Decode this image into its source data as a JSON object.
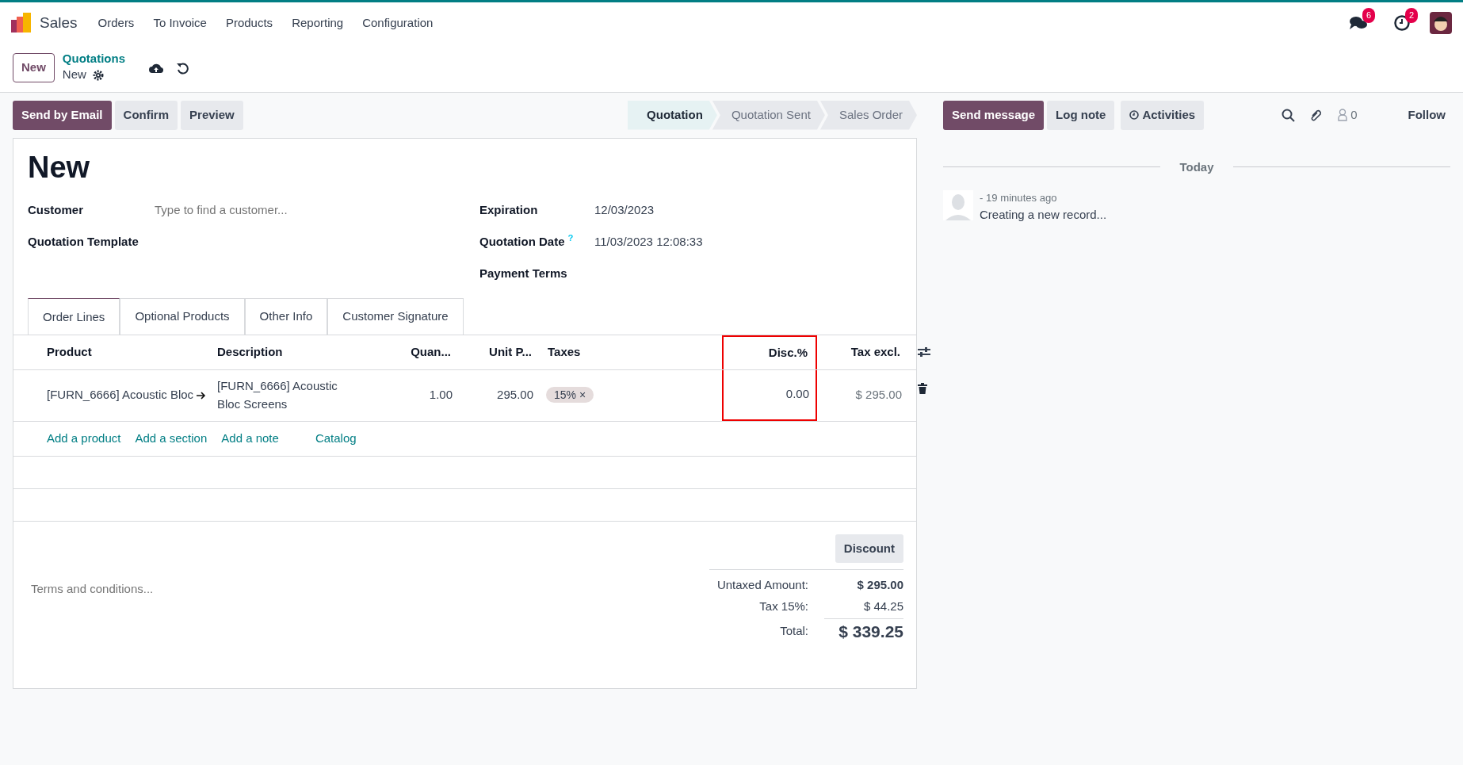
{
  "navbar": {
    "app": "Sales",
    "menu": [
      "Orders",
      "To Invoice",
      "Products",
      "Reporting",
      "Configuration"
    ],
    "messages_badge": "6",
    "activities_badge": "2"
  },
  "control_panel": {
    "new_button": "New",
    "breadcrumb": "Quotations",
    "record": "New"
  },
  "actions": [
    {
      "label": "Send by Email",
      "primary": true
    },
    {
      "label": "Confirm",
      "primary": false
    },
    {
      "label": "Preview",
      "primary": false
    }
  ],
  "stages": [
    {
      "label": "Quotation",
      "selected": true
    },
    {
      "label": "Quotation Sent",
      "selected": false
    },
    {
      "label": "Sales Order",
      "selected": false
    }
  ],
  "form": {
    "title": "New",
    "left_fields": [
      {
        "label": "Customer",
        "placeholder": "Type to find a customer..."
      },
      {
        "label": "Quotation Template"
      }
    ],
    "right_fields": [
      {
        "label": "Expiration",
        "value": "12/03/2023"
      },
      {
        "label": "Quotation Date",
        "help": "?",
        "value": "11/03/2023 12:08:33"
      },
      {
        "label": "Payment Terms"
      }
    ],
    "tabs": [
      {
        "label": "Order Lines",
        "selected": true
      },
      {
        "label": "Optional Products",
        "selected": false
      },
      {
        "label": "Other Info",
        "selected": false
      },
      {
        "label": "Customer Signature",
        "selected": false
      }
    ],
    "table": {
      "columns": [
        {
          "label": "Product",
          "kind": "text",
          "highlighted": false
        },
        {
          "label": "Description",
          "kind": "text",
          "highlighted": false
        },
        {
          "label": "Quan...",
          "kind": "number",
          "highlighted": false
        },
        {
          "label": "Unit P...",
          "kind": "number",
          "highlighted": false
        },
        {
          "label": "Taxes",
          "kind": "text",
          "highlighted": false
        },
        {
          "label": "Disc.%",
          "kind": "number",
          "highlighted": true
        },
        {
          "label": "Tax excl.",
          "kind": "number",
          "highlighted": false
        }
      ],
      "rows": [
        {
          "product": "[FURN_6666] Acoustic Bloc",
          "description": "[FURN_6666] Acoustic Bloc Screens",
          "quantity": "1.00",
          "unit_price": "295.00",
          "tax_tag": "15%",
          "remove": "×",
          "discount": "0.00",
          "subtotal": "$ 295.00"
        }
      ],
      "add_links": [
        "Add a product",
        "Add a section",
        "Add a note",
        "Catalog"
      ]
    },
    "discount_button": "Discount",
    "terms_placeholder": "Terms and conditions...",
    "totals": [
      {
        "label": "Untaxed Amount:",
        "value": "$ 295.00",
        "kind": "bold"
      },
      {
        "label": "Tax 15%:",
        "value": "$ 44.25",
        "kind": "plain"
      },
      {
        "label": "Total:",
        "value": "$ 339.25",
        "kind": "grand"
      }
    ]
  },
  "chatter": {
    "buttons": [
      {
        "label": "Send message",
        "selected": true
      },
      {
        "label": "Log note",
        "selected": false
      },
      {
        "label": "Activities",
        "selected": false
      }
    ],
    "followers": "0",
    "follow": "Follow",
    "date_separator": "Today",
    "messages": [
      {
        "time": "- 19 minutes ago",
        "body": "Creating a new record..."
      }
    ]
  }
}
